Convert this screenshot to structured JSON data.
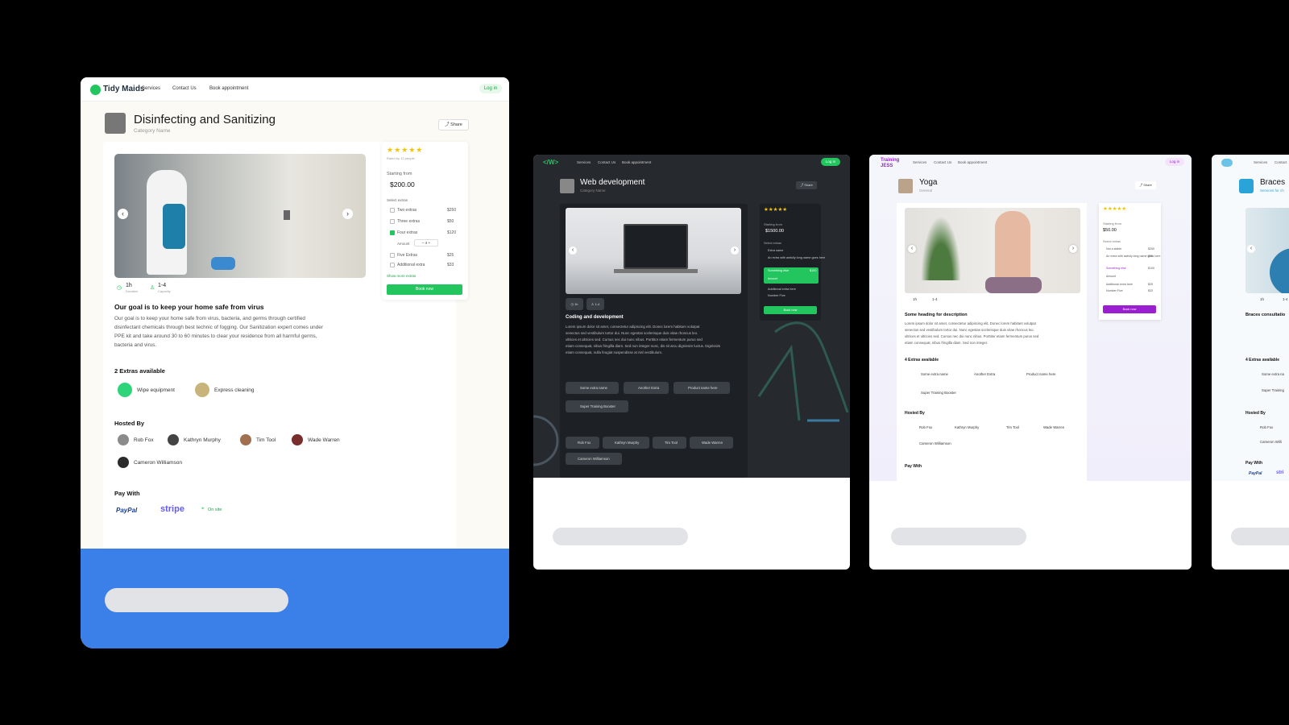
{
  "colors": {
    "green": "#22c55e",
    "blue_footer": "#3b7fe8",
    "purple": "#9b1fd0",
    "dark_bg": "#262a2e"
  },
  "card1": {
    "brand": "Tidy Maids",
    "nav": [
      "Services",
      "Contact Us",
      "Book appointment"
    ],
    "login": "Log in",
    "title": "Disinfecting and Sanitizing",
    "category": "Category Name",
    "share": "Share",
    "rated_by": "Rated by 12 people",
    "starting_from": "Starting from",
    "price": "$200.00",
    "select_extras": "Select extras",
    "extras": [
      {
        "name": "Two extras",
        "price": "$250",
        "checked": false
      },
      {
        "name": "Three extras",
        "price": "$50",
        "checked": false
      },
      {
        "name": "Four extras",
        "price": "$120",
        "checked": true
      },
      {
        "name": "Five Extras",
        "price": "$25",
        "checked": false
      },
      {
        "name": "Additional extra",
        "price": "$33",
        "checked": false
      }
    ],
    "amount_label": "Amount",
    "amount_value": "4",
    "show_more": "Show more extras",
    "book_now": "Book now",
    "duration_value": "1h",
    "duration_label": "Duration",
    "capacity_value": "1-4",
    "capacity_label": "Capacity",
    "goal_heading": "Our goal is to keep your home safe from virus",
    "description": [
      "Our goal is to keep your home safe from virus, bacteria, and germs through certified",
      "disinfectant chemicals through best technic of fogging. Our Sanitization expert comes under",
      "PPE kit and take around 30 to 60 minutes to clear your residence from all harmful germs,",
      "bacteria and virus."
    ],
    "extras_available": "2 Extras available",
    "extra_items": [
      "Wipe equipment",
      "Express cleaning"
    ],
    "hosted_by": "Hosted By",
    "hosts": [
      "Rob Fox",
      "Kathryn Murphy",
      "Tim Tool",
      "Wade Warren",
      "Cameron Williamson"
    ],
    "pay_with": "Pay With",
    "paypal": "PayPal",
    "stripe": "stripe",
    "on_site": "On site"
  },
  "card2": {
    "brand": "</W>",
    "nav": [
      "Services",
      "Contact Us",
      "Book appointment"
    ],
    "login": "Log in",
    "title": "Web development",
    "category": "Category Name",
    "share": "Share",
    "price": "$1500.00",
    "starting_from": "Starting from",
    "select_extras": "Select extras",
    "extras": [
      "Extra name",
      "An extra with awfully long name goes here",
      "Something else",
      "Additional extra here",
      "Number Five"
    ],
    "extra_price": "$100",
    "amount_label": "Amount",
    "book_now": "Book now",
    "duration_value": "1h",
    "capacity_value": "1-4",
    "heading": "Coding and development",
    "description": [
      "Lorem ipsum dolor sit amet, consectetur adipiscing elit. Donec lorem habitum volutpat",
      "senectus sed vestibulum tortor dui. Nunc egestas scelerisque duis vitae rhoncus leo.",
      "ultrices et ultricies sed. Cursus nec dui nunc nibus. Porttitor etiam fermentum purus sed",
      "etiam consequat, nibus fringilla diam. Sed non integer nunc, dis sit arcu dignissim luctus. Dignissim",
      "etiam consequat, nulla feugiat suspendisse at nisl vestibulum."
    ],
    "extra_chips": [
      "Some extra name",
      "Another Extra",
      "Product name here",
      "Super Training Booster"
    ],
    "hosts": [
      "Rob Fox",
      "Kathryn Murphy",
      "Tim Tool",
      "Wade Warren",
      "Cameron Williamson"
    ]
  },
  "card3": {
    "brand_line1": "Training",
    "brand_line2": "JESS",
    "nav": [
      "Services",
      "Contact Us",
      "Book appointment"
    ],
    "login": "Log in",
    "title": "Yoga",
    "category": "General",
    "share": "Share",
    "price": "$50.00",
    "starting_from": "Starting from",
    "select_extras": "Select extras",
    "extras": [
      {
        "name": "Not a stable",
        "price": "$250"
      },
      {
        "name": "An extra with awfully long name goes here",
        "price": "$50"
      },
      {
        "name": "Something else",
        "price": "$100"
      },
      {
        "name": "Additional extra here",
        "price": "$25"
      },
      {
        "name": "Number Five",
        "price": "$33"
      }
    ],
    "amount_label": "Amount",
    "book_now": "Book now",
    "duration_value": "1h",
    "capacity_value": "1-4",
    "heading": "Some heading for description",
    "description": [
      "Lorem ipsum dolor sit amet, consectetur adipiscing elit. Donec lorem habitant volutpat",
      "senectus sed vestibulum tortor dui. Nunc egestas scelerisque duis vitae rhoncus leo.",
      "ultrices et ultricies sed. Cursus nec dui nunc nibus. Porttitor etiam fermentum purus sed",
      "etiam consequat, nibus fringilla diam. Sed non integer."
    ],
    "extras_available": "4 Extras available",
    "extra_chips": [
      "Some extra name",
      "Another Extra",
      "Product name here",
      "Super Training Booster"
    ],
    "hosted_by": "Hosted By",
    "hosts": [
      "Rob Fox",
      "Kathryn Murphy",
      "Tim Tool",
      "Wade Warren",
      "Cameron Williamson"
    ],
    "pay_with": "Pay With"
  },
  "card4": {
    "nav": [
      "Services",
      "Contact"
    ],
    "title": "Braces",
    "category": "Services for ch",
    "duration_value": "1h",
    "capacity_value": "1-4",
    "heading": "Braces consultatio",
    "extras_available": "4 Extras available",
    "extra_chips": [
      "Some extra na",
      "Super Training"
    ],
    "hosted_by": "Hosted By",
    "hosts": [
      "Rob Fox",
      "Cameron Willi"
    ],
    "pay_with": "Pay With",
    "paypal": "PayPal",
    "stripe": "stri"
  }
}
